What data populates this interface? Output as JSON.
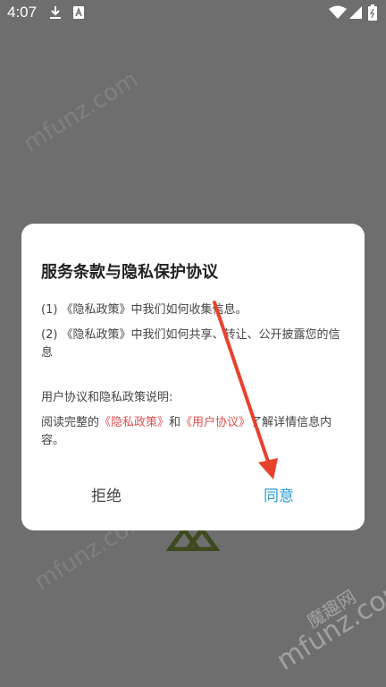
{
  "status_bar": {
    "time": "4:07",
    "icons": [
      "download-icon",
      "a-notification-icon",
      "wifi-icon",
      "signal-icon",
      "battery-icon"
    ]
  },
  "watermark": {
    "text": "mfunz.com",
    "brand": "魔趣网"
  },
  "dialog": {
    "title": "服务条款与隐私保护协议",
    "item1": "(1) 《隐私政策》中我们如何收集信息。",
    "item2": "(2) 《隐私政策》中我们如何共享、转让、公开披露您的信息",
    "explain_heading": "用户协议和隐私政策说明:",
    "read_prefix": "阅读完整的",
    "privacy_link": "《隐私政策》",
    "and_text": "和",
    "user_link": "《用户协议》",
    "read_suffix": "了解详情信息内容。",
    "reject_label": "拒绝",
    "agree_label": "同意"
  },
  "colors": {
    "overlay": "#6e6e6e",
    "link": "#e05050",
    "agree": "#2a9bd8",
    "arrow": "#e8412c"
  }
}
